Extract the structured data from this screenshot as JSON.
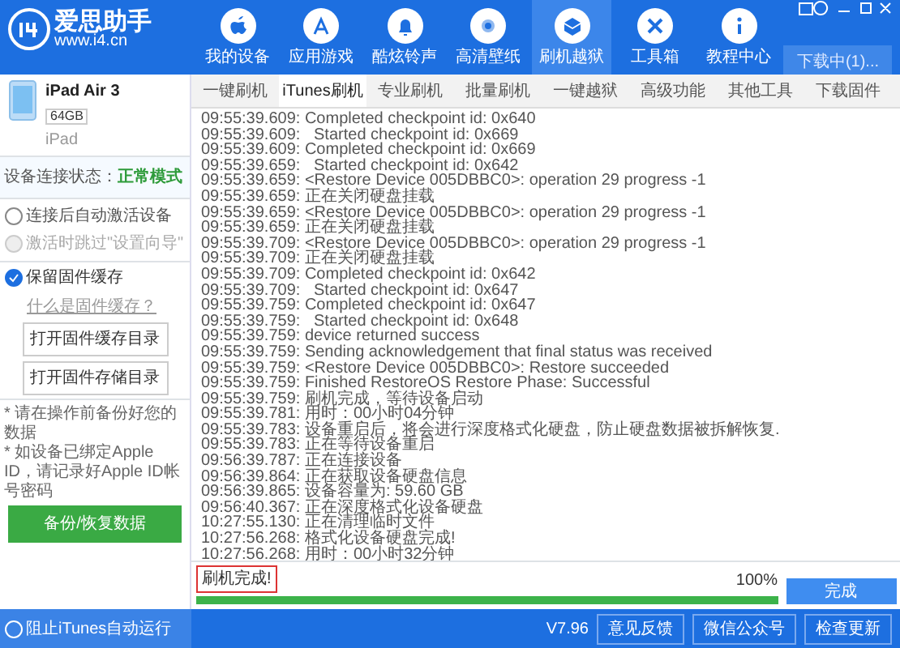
{
  "app": {
    "logo_name": "爱思助手",
    "logo_url": "www.i4.cn"
  },
  "nav": [
    {
      "label": "我的设备",
      "selected": false
    },
    {
      "label": "应用游戏",
      "selected": false
    },
    {
      "label": "酷炫铃声",
      "selected": false
    },
    {
      "label": "高清壁纸",
      "selected": false
    },
    {
      "label": "刷机越狱",
      "selected": true
    },
    {
      "label": "工具箱",
      "selected": false
    },
    {
      "label": "教程中心",
      "selected": false
    }
  ],
  "download_button": "下载中(1)...",
  "device": {
    "name": "iPad Air 3",
    "capacity": "64GB",
    "type": "iPad"
  },
  "connection": {
    "label": "设备连接状态：",
    "value": "正常模式"
  },
  "options": [
    {
      "label": "连接后自动激活设备",
      "checked": false,
      "disabled": false
    },
    {
      "label": "激活时跳过\"设置向导\"",
      "checked": false,
      "disabled": true
    }
  ],
  "firmware_cache": {
    "label": "保留固件缓存",
    "checked": true,
    "link": "什么是固件缓存？"
  },
  "sidebar_buttons": [
    "打开固件缓存目录",
    "打开固件存储目录"
  ],
  "notes": [
    "* 请在操作前备份好您的数据",
    "* 如设备已绑定Apple ID，请记录好Apple ID帐号密码"
  ],
  "backup_button": "备份/恢复数据",
  "tabs": [
    {
      "label": "一键刷机",
      "selected": false
    },
    {
      "label": "iTunes刷机",
      "selected": true
    },
    {
      "label": "专业刷机",
      "selected": false
    },
    {
      "label": "批量刷机",
      "selected": false
    },
    {
      "label": "一键越狱",
      "selected": false
    },
    {
      "label": "高级功能",
      "selected": false
    },
    {
      "label": "其他工具",
      "selected": false
    },
    {
      "label": "下载固件",
      "selected": false
    }
  ],
  "log": [
    {
      "time": "09:55:39.609:",
      "text": "Completed checkpoint id: 0x640"
    },
    {
      "time": "09:55:39.609:",
      "text": "  Started checkpoint id: 0x669"
    },
    {
      "time": "09:55:39.609:",
      "text": "Completed checkpoint id: 0x669"
    },
    {
      "time": "09:55:39.659:",
      "text": "  Started checkpoint id: 0x642"
    },
    {
      "time": "09:55:39.659:",
      "text": "<Restore Device 005DBBC0>: operation 29 progress -1"
    },
    {
      "time": "09:55:39.659:",
      "text": "正在关闭硬盘挂载"
    },
    {
      "time": "09:55:39.659:",
      "text": "<Restore Device 005DBBC0>: operation 29 progress -1"
    },
    {
      "time": "09:55:39.659:",
      "text": "正在关闭硬盘挂载"
    },
    {
      "time": "09:55:39.709:",
      "text": "<Restore Device 005DBBC0>: operation 29 progress -1"
    },
    {
      "time": "09:55:39.709:",
      "text": "正在关闭硬盘挂载"
    },
    {
      "time": "09:55:39.709:",
      "text": "Completed checkpoint id: 0x642"
    },
    {
      "time": "09:55:39.709:",
      "text": "  Started checkpoint id: 0x647"
    },
    {
      "time": "09:55:39.759:",
      "text": "Completed checkpoint id: 0x647"
    },
    {
      "time": "09:55:39.759:",
      "text": "  Started checkpoint id: 0x648"
    },
    {
      "time": "09:55:39.759:",
      "text": "device returned success"
    },
    {
      "time": "09:55:39.759:",
      "text": "Sending acknowledgement that final status was received"
    },
    {
      "time": "09:55:39.759:",
      "text": "<Restore Device 005DBBC0>: Restore succeeded"
    },
    {
      "time": "09:55:39.759:",
      "text": "Finished RestoreOS Restore Phase: Successful"
    },
    {
      "time": "09:55:39.759:",
      "text": "刷机完成，等待设备启动"
    },
    {
      "time": "09:55:39.781:",
      "text": "用时：00小时04分钟"
    },
    {
      "time": "09:55:39.783:",
      "text": "设备重启后，将会进行深度格式化硬盘，防止硬盘数据被拆解恢复."
    },
    {
      "time": "09:55:39.783:",
      "text": "正在等待设备重启"
    },
    {
      "time": "09:56:39.787:",
      "text": "正在连接设备"
    },
    {
      "time": "09:56:39.864:",
      "text": "正在获取设备硬盘信息"
    },
    {
      "time": "09:56:39.865:",
      "text": "设备容量为: 59.60 GB"
    },
    {
      "time": "09:56:40.367:",
      "text": "正在深度格式化设备硬盘"
    },
    {
      "time": "10:27:55.130:",
      "text": "正在清理临时文件"
    },
    {
      "time": "10:27:56.268:",
      "text": "格式化设备硬盘完成!"
    },
    {
      "time": "10:27:56.268:",
      "text": "用时：00小时32分钟"
    }
  ],
  "status": "刷机完成!",
  "progress": {
    "level": 1.0,
    "reading": "100%"
  },
  "done_button": "完成",
  "footer": {
    "itunes_option": {
      "label": "阻止iTunes自动运行",
      "checked": false
    },
    "version": "V7.96",
    "buttons": [
      "意见反馈",
      "微信公众号",
      "检查更新"
    ]
  }
}
